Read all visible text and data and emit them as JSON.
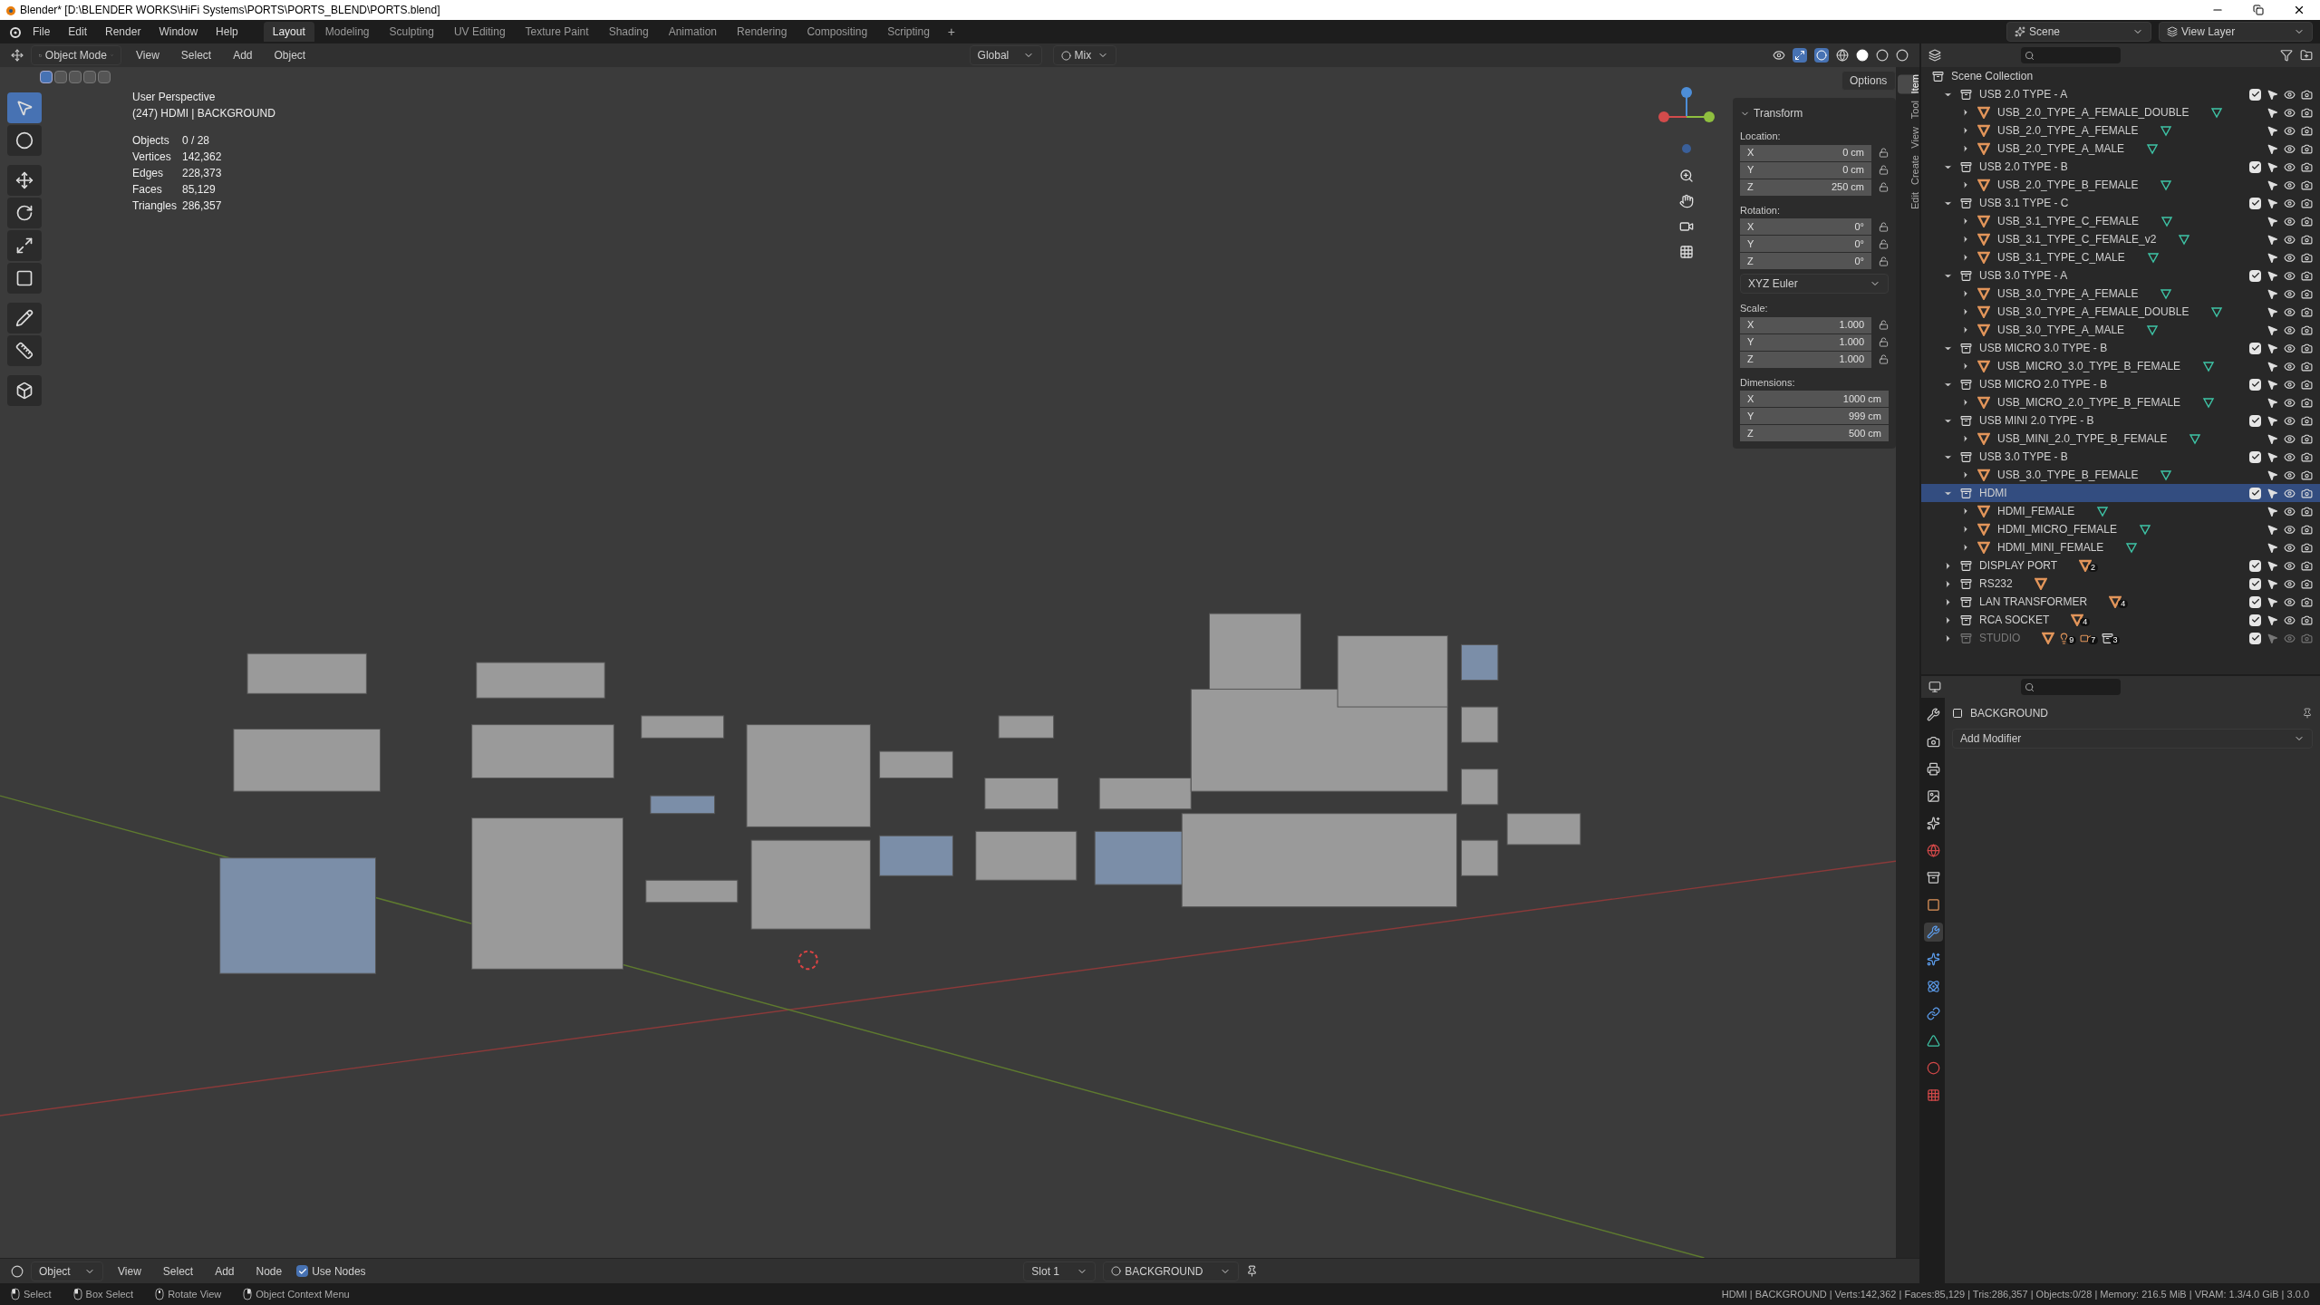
{
  "window": {
    "title": "Blender* [D:\\BLENDER WORKS\\HiFi Systems\\PORTS\\PORTS_BLEND\\PORTS.blend]"
  },
  "menu": [
    "File",
    "Edit",
    "Render",
    "Window",
    "Help"
  ],
  "workspaces": [
    {
      "label": "Layout",
      "selected": true
    },
    {
      "label": "Modeling",
      "selected": false
    },
    {
      "label": "Sculpting",
      "selected": false
    },
    {
      "label": "UV Editing",
      "selected": false
    },
    {
      "label": "Texture Paint",
      "selected": false
    },
    {
      "label": "Shading",
      "selected": false
    },
    {
      "label": "Animation",
      "selected": false
    },
    {
      "label": "Rendering",
      "selected": false
    },
    {
      "label": "Compositing",
      "selected": false
    },
    {
      "label": "Scripting",
      "selected": false
    }
  ],
  "add_workspace": "+",
  "scene": {
    "scene": "Scene",
    "view_layer": "View Layer"
  },
  "viewport_header": {
    "mode": "Object Mode",
    "menus": [
      "View",
      "Select",
      "Add",
      "Object"
    ],
    "orientation": "Global",
    "snap": "Mix",
    "options": "Options"
  },
  "select_modes": [
    {
      "selected": true
    },
    {
      "selected": false
    },
    {
      "selected": false
    },
    {
      "selected": false
    },
    {
      "selected": false
    }
  ],
  "tools": [
    {
      "kind": "select",
      "selected": true
    },
    {
      "kind": "cursor",
      "selected": false
    },
    {
      "kind": "move",
      "selected": false
    },
    {
      "kind": "rotate",
      "selected": false
    },
    {
      "kind": "scale",
      "selected": false
    },
    {
      "kind": "transform",
      "selected": false
    },
    {
      "kind": "annotate",
      "selected": false
    },
    {
      "kind": "measure",
      "selected": false
    },
    {
      "kind": "add",
      "selected": false
    }
  ],
  "viewport_info": {
    "view": "User Perspective",
    "object": "(247) HDMI | BACKGROUND",
    "stats": [
      {
        "label": "Objects",
        "value": "0 / 28"
      },
      {
        "label": "Vertices",
        "value": "142,362"
      },
      {
        "label": "Edges",
        "value": "228,373"
      },
      {
        "label": "Faces",
        "value": "85,129"
      },
      {
        "label": "Triangles",
        "value": "286,357"
      }
    ]
  },
  "transform": {
    "title": "Transform",
    "groups": [
      {
        "label": "Location:",
        "locks": true,
        "fields": [
          {
            "axis": "X",
            "value": "0 cm"
          },
          {
            "axis": "Y",
            "value": "0 cm"
          },
          {
            "axis": "Z",
            "value": "250 cm"
          }
        ]
      },
      {
        "label": "Rotation:",
        "locks": true,
        "fields": [
          {
            "axis": "X",
            "value": "0°"
          },
          {
            "axis": "Y",
            "value": "0°"
          },
          {
            "axis": "Z",
            "value": "0°"
          }
        ],
        "mode": "XYZ Euler"
      },
      {
        "label": "Scale:",
        "locks": true,
        "fields": [
          {
            "axis": "X",
            "value": "1.000"
          },
          {
            "axis": "Y",
            "value": "1.000"
          },
          {
            "axis": "Z",
            "value": "1.000"
          }
        ]
      },
      {
        "label": "Dimensions:",
        "locks": false,
        "fields": [
          {
            "axis": "X",
            "value": "1000 cm"
          },
          {
            "axis": "Y",
            "value": "999 cm"
          },
          {
            "axis": "Z",
            "value": "500 cm"
          }
        ]
      }
    ]
  },
  "sidebar_tabs": [
    {
      "label": "Item",
      "selected": true
    },
    {
      "label": "Tool",
      "selected": false
    },
    {
      "label": "View",
      "selected": false
    },
    {
      "label": "Create",
      "selected": false
    },
    {
      "label": "Edit",
      "selected": false
    }
  ],
  "outliner": {
    "root": "Scene Collection",
    "items": [
      {
        "name": "USB 2.0 TYPE - A",
        "expanded": true,
        "selected": false,
        "checked": true,
        "disabled": false,
        "children": [
          {
            "name": "USB_2.0_TYPE_A_FEMALE_DOUBLE"
          },
          {
            "name": "USB_2.0_TYPE_A_FEMALE"
          },
          {
            "name": "USB_2.0_TYPE_A_MALE"
          }
        ]
      },
      {
        "name": "USB 2.0 TYPE - B",
        "expanded": true,
        "selected": false,
        "checked": true,
        "disabled": false,
        "children": [
          {
            "name": "USB_2.0_TYPE_B_FEMALE"
          }
        ]
      },
      {
        "name": "USB 3.1 TYPE - C",
        "expanded": true,
        "selected": false,
        "checked": true,
        "disabled": false,
        "children": [
          {
            "name": "USB_3.1_TYPE_C_FEMALE"
          },
          {
            "name": "USB_3.1_TYPE_C_FEMALE_v2"
          },
          {
            "name": "USB_3.1_TYPE_C_MALE"
          }
        ]
      },
      {
        "name": "USB 3.0 TYPE - A",
        "expanded": true,
        "selected": false,
        "checked": true,
        "disabled": false,
        "children": [
          {
            "name": "USB_3.0_TYPE_A_FEMALE"
          },
          {
            "name": "USB_3.0_TYPE_A_FEMALE_DOUBLE"
          },
          {
            "name": "USB_3.0_TYPE_A_MALE"
          }
        ]
      },
      {
        "name": "USB MICRO 3.0 TYPE - B",
        "expanded": true,
        "selected": false,
        "checked": true,
        "disabled": false,
        "children": [
          {
            "name": "USB_MICRO_3.0_TYPE_B_FEMALE"
          }
        ]
      },
      {
        "name": "USB MICRO 2.0 TYPE - B",
        "expanded": true,
        "selected": false,
        "checked": true,
        "disabled": false,
        "children": [
          {
            "name": "USB_MICRO_2.0_TYPE_B_FEMALE"
          }
        ]
      },
      {
        "name": "USB MINI 2.0 TYPE - B",
        "expanded": true,
        "selected": false,
        "checked": true,
        "disabled": false,
        "children": [
          {
            "name": "USB_MINI_2.0_TYPE_B_FEMALE"
          }
        ]
      },
      {
        "name": "USB 3.0 TYPE - B",
        "expanded": true,
        "selected": false,
        "checked": true,
        "disabled": false,
        "children": [
          {
            "name": "USB_3.0_TYPE_B_FEMALE"
          }
        ]
      },
      {
        "name": "HDMI",
        "expanded": true,
        "selected": true,
        "checked": true,
        "disabled": false,
        "children": [
          {
            "name": "HDMI_FEMALE"
          },
          {
            "name": "HDMI_MICRO_FEMALE"
          },
          {
            "name": "HDMI_MINI_FEMALE"
          }
        ]
      },
      {
        "name": "DISPLAY PORT",
        "expanded": false,
        "selected": false,
        "checked": true,
        "disabled": false,
        "contents": [
          {
            "kind": "mesh",
            "count": "2"
          }
        ]
      },
      {
        "name": "RS232",
        "expanded": false,
        "selected": false,
        "checked": true,
        "disabled": false,
        "contents": [
          {
            "kind": "mesh"
          }
        ]
      },
      {
        "name": "LAN TRANSFORMER",
        "expanded": false,
        "selected": false,
        "checked": true,
        "disabled": false,
        "contents": [
          {
            "kind": "mesh",
            "count": "4"
          }
        ]
      },
      {
        "name": "RCA SOCKET",
        "expanded": false,
        "selected": false,
        "checked": true,
        "disabled": false,
        "contents": [
          {
            "kind": "mesh",
            "count": "4"
          }
        ]
      },
      {
        "name": "STUDIO",
        "expanded": false,
        "selected": false,
        "checked": true,
        "disabled": true,
        "contents": [
          {
            "kind": "mesh"
          },
          {
            "kind": "light",
            "count": "9"
          },
          {
            "kind": "camera",
            "count": "7"
          },
          {
            "kind": "collection",
            "count": "3"
          }
        ]
      }
    ]
  },
  "properties": {
    "object": "BACKGROUND",
    "add_modifier": "Add Modifier",
    "tabs": [
      {
        "kind": "tool",
        "selected": false
      },
      {
        "kind": "render",
        "selected": false
      },
      {
        "kind": "output",
        "selected": false
      },
      {
        "kind": "view_layer",
        "selected": false
      },
      {
        "kind": "scene",
        "selected": false
      },
      {
        "kind": "world",
        "selected": false
      },
      {
        "kind": "collection",
        "selected": false
      },
      {
        "kind": "object",
        "selected": false
      },
      {
        "kind": "modifier",
        "selected": true
      },
      {
        "kind": "particles",
        "selected": false
      },
      {
        "kind": "physics",
        "selected": false
      },
      {
        "kind": "constraints",
        "selected": false
      },
      {
        "kind": "data",
        "selected": false
      },
      {
        "kind": "material",
        "selected": false
      },
      {
        "kind": "texture",
        "selected": false
      }
    ]
  },
  "node_header": {
    "editor": "Object",
    "menus": [
      "View",
      "Select",
      "Add",
      "Node"
    ],
    "use_nodes": {
      "label": "Use Nodes",
      "checked": true
    },
    "slot": "Slot 1",
    "material": "BACKGROUND"
  },
  "status_bar": {
    "hints": [
      {
        "kind": "left",
        "label": "Select"
      },
      {
        "kind": "left",
        "label": "Box Select"
      },
      {
        "kind": "middle",
        "label": "Rotate View"
      },
      {
        "kind": "right",
        "label": "Object Context Menu"
      }
    ],
    "info": "HDMI | BACKGROUND | Verts:142,362 | Faces:85,129 | Tris:286,357 | Objects:0/28 | Memory: 216.5 MiB | VRAM: 1.3/4.0 GiB | 3.0.0"
  }
}
